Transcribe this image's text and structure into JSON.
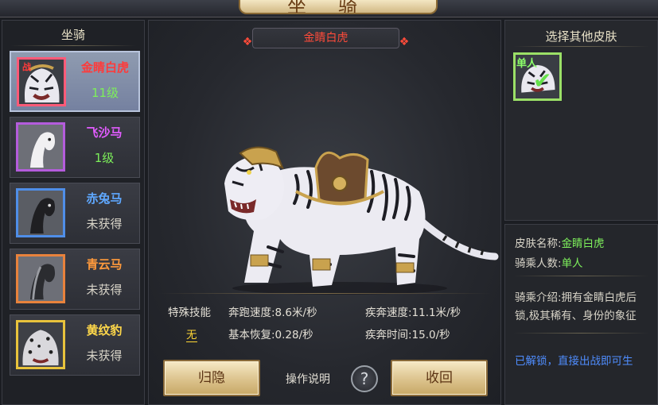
{
  "window": {
    "title": "坐骑"
  },
  "left": {
    "title": "坐骑",
    "items": [
      {
        "name": "金睛白虎",
        "status": "11级",
        "battle_tag": "战",
        "name_color": "#ff3a3a",
        "status_color": "#7df05a",
        "frame_color": "#ff5a78",
        "selected": true,
        "icon": "white-tiger-icon"
      },
      {
        "name": "飞沙马",
        "status": "1级",
        "name_color": "#e25cff",
        "status_color": "#7df05a",
        "frame_color": "#b45cdc",
        "selected": false,
        "icon": "white-horse-icon"
      },
      {
        "name": "赤兔马",
        "status": "未获得",
        "name_color": "#5fa8ff",
        "status_color": "#d8d4c8",
        "frame_color": "#4f8ee8",
        "selected": false,
        "icon": "black-horse-icon"
      },
      {
        "name": "青云马",
        "status": "未获得",
        "name_color": "#ff9a3c",
        "status_color": "#d8d4c8",
        "frame_color": "#e8823c",
        "selected": false,
        "icon": "grey-horse-icon"
      },
      {
        "name": "黄纹豹",
        "status": "未获得",
        "name_color": "#ffd84a",
        "status_color": "#d8d4c8",
        "frame_color": "#e8c33c",
        "selected": false,
        "icon": "leopard-icon"
      }
    ]
  },
  "center": {
    "mount_name": "金睛白虎",
    "stats": {
      "skill_label": "特殊技能",
      "skill_value": "无",
      "run_speed": "奔跑速度:8.6米/秒",
      "sprint_speed": "疾奔速度:11.1米/秒",
      "recovery": "基本恢复:0.28/秒",
      "sprint_time": "疾奔时间:15.0/秒"
    },
    "buttons": {
      "dismount": "归隐",
      "help_label": "操作说明",
      "help_icon": "?",
      "recall": "收回"
    }
  },
  "right": {
    "skins_title": "选择其他皮肤",
    "skins": [
      {
        "label": "单人",
        "icon": "white-tiger-icon",
        "checked": true
      }
    ],
    "info": {
      "skin_name_label": "皮肤名称:",
      "skin_name_value": "金睛白虎",
      "riders_label": "骑乘人数:",
      "riders_value": "单人",
      "intro_line1": "骑乘介绍:拥有金睛白虎后",
      "intro_line2": "锁,极其稀有、身份的象征",
      "unlock_text": "已解锁，直接出战即可生"
    }
  },
  "colors": {
    "accent_gold": "#dcc38d",
    "name_red": "#ff3a3a",
    "green": "#7ef05c",
    "blue": "#4f8dff"
  }
}
